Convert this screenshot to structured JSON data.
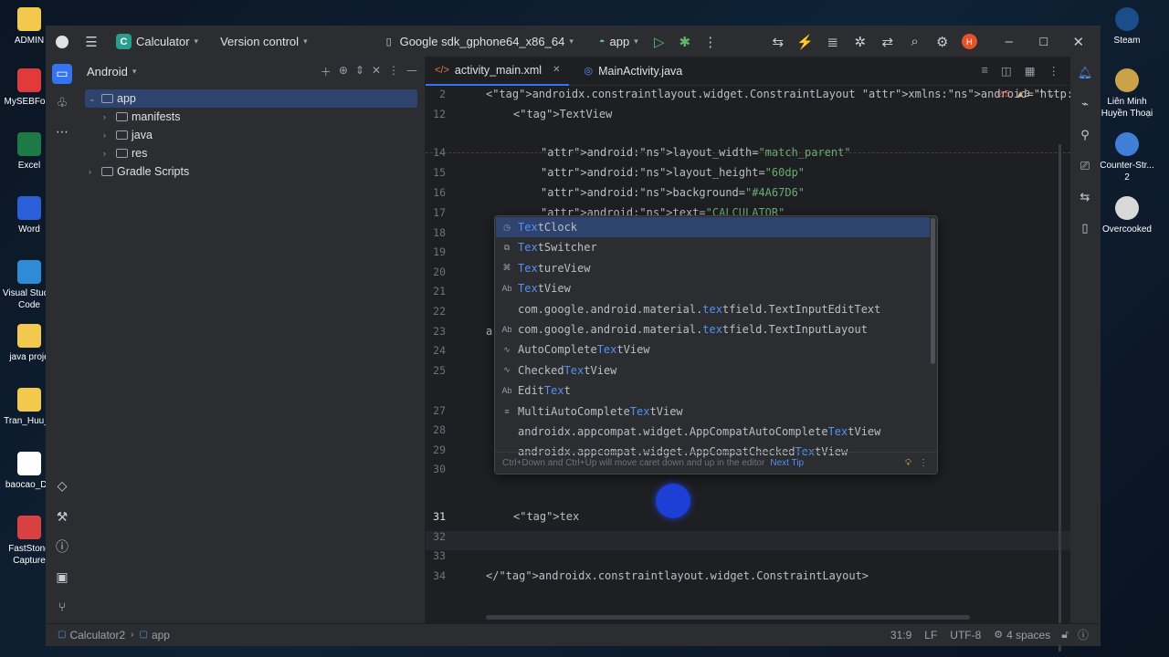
{
  "desktop": {
    "icons_left": [
      {
        "label": "ADMIN",
        "color": "#f2c94c"
      },
      {
        "label": "MySEBForS",
        "color": "#e03a3a"
      },
      {
        "label": "Excel",
        "color": "#1d7a45"
      },
      {
        "label": "Word",
        "color": "#2b5fd9"
      },
      {
        "label": "Visual Studio Code",
        "color": "#2f8ad8"
      },
      {
        "label": "java proje",
        "color": "#f2c94c"
      },
      {
        "label": "Tran_Huu_T",
        "color": "#f2c94c"
      },
      {
        "label": "baocao_DA",
        "color": "#ffffff"
      },
      {
        "label": "FastStone Capture",
        "color": "#d94040"
      }
    ],
    "icons_right": [
      {
        "label": "Steam",
        "color": "#1b4d8a"
      },
      {
        "label": "Liên Minh Huyền Thoại",
        "color": "#c9a24a"
      },
      {
        "label": "Counter-Str... 2",
        "color": "#3f7fd8"
      },
      {
        "label": "Overcooked",
        "color": "#d9d9d9"
      }
    ]
  },
  "titlebar": {
    "project_initial": "C",
    "project_name": "Calculator",
    "vcs": "Version control",
    "device": "Google sdk_gphone64_x86_64",
    "run_config": "app",
    "avatar_initial": "H"
  },
  "project_panel": {
    "view": "Android",
    "tree": [
      {
        "label": "app",
        "depth": 0,
        "expanded": true,
        "selected": true
      },
      {
        "label": "manifests",
        "depth": 1,
        "expanded": false,
        "selected": false
      },
      {
        "label": "java",
        "depth": 1,
        "expanded": false,
        "selected": false
      },
      {
        "label": "res",
        "depth": 1,
        "expanded": false,
        "selected": false
      },
      {
        "label": "Gradle Scripts",
        "depth": 0,
        "expanded": false,
        "selected": false
      }
    ]
  },
  "editor": {
    "tabs": [
      {
        "label": "activity_main.xml",
        "active": true
      },
      {
        "label": "MainActivity.java",
        "active": false
      }
    ],
    "inspection_counts": {
      "warnings": "5",
      "weak": "3"
    },
    "lines": [
      {
        "n": "2",
        "text": "<androidx.constraintlayout.widget.ConstraintLayout xmlns:android=\"http://sc"
      },
      {
        "n": "12",
        "text": "<TextView"
      },
      {
        "n": "14",
        "text": "android:layout_width=\"match_parent\""
      },
      {
        "n": "15",
        "text": "android:layout_height=\"60dp\""
      },
      {
        "n": "16",
        "text": "android:background=\"#4A67D6\""
      },
      {
        "n": "17",
        "text": "android:text=\"CALCULATOR\""
      },
      {
        "n": "18",
        "text": ""
      },
      {
        "n": "19",
        "text": ""
      },
      {
        "n": "20",
        "text": ""
      },
      {
        "n": "21",
        "text": ""
      },
      {
        "n": "22",
        "text": ""
      },
      {
        "n": "23",
        "text": "ar"
      },
      {
        "n": "24",
        "text": ""
      },
      {
        "n": "25",
        "text": ""
      },
      {
        "n": "27",
        "text": ""
      },
      {
        "n": "28",
        "text": ""
      },
      {
        "n": "29",
        "text": ""
      },
      {
        "n": "30",
        "text": ""
      },
      {
        "n": "31",
        "text": "<tex"
      },
      {
        "n": "32",
        "text": ""
      },
      {
        "n": "33",
        "text": ""
      },
      {
        "n": "34",
        "text": "</androidx.constraintlayout.widget.ConstraintLayout>"
      }
    ]
  },
  "autocomplete": {
    "items": [
      {
        "icon": "clock",
        "pre": "",
        "match": "Tex",
        "post": "tClock",
        "selected": true
      },
      {
        "icon": "switcher",
        "pre": "",
        "match": "Tex",
        "post": "tSwitcher",
        "selected": false
      },
      {
        "icon": "texture",
        "pre": "",
        "match": "Tex",
        "post": "tureView",
        "selected": false
      },
      {
        "icon": "Ab",
        "pre": "",
        "match": "Tex",
        "post": "tView",
        "selected": false
      },
      {
        "icon": "",
        "pre": "com.google.android.material.",
        "match": "tex",
        "post": "tfield.TextInputEditText",
        "selected": false
      },
      {
        "icon": "Ab",
        "pre": "com.google.android.material.",
        "match": "tex",
        "post": "tfield.TextInputLayout",
        "selected": false
      },
      {
        "icon": "auto",
        "pre": "AutoComplete",
        "match": "Tex",
        "post": "tView",
        "selected": false
      },
      {
        "icon": "check",
        "pre": "Checked",
        "match": "Tex",
        "post": "tView",
        "selected": false
      },
      {
        "icon": "Ab",
        "pre": "Edit",
        "match": "Tex",
        "post": "t",
        "selected": false
      },
      {
        "icon": "multi",
        "pre": "MultiAutoComplete",
        "match": "Tex",
        "post": "tView",
        "selected": false
      },
      {
        "icon": "",
        "pre": "androidx.appcompat.widget.AppCompatAutoComplete",
        "match": "Tex",
        "post": "tView",
        "selected": false
      },
      {
        "icon": "",
        "pre": "androidx.appcompat.widget.AppCompatChecked",
        "match": "Tex",
        "post": "tView",
        "selected": false
      }
    ],
    "hint": "Ctrl+Down and Ctrl+Up will move caret down and up in the editor",
    "next_tip": "Next Tip"
  },
  "statusbar": {
    "breadcrumb_root": "Calculator2",
    "breadcrumb_module": "app",
    "position": "31:9",
    "line_sep": "LF",
    "encoding": "UTF-8",
    "indent": "4 spaces"
  }
}
